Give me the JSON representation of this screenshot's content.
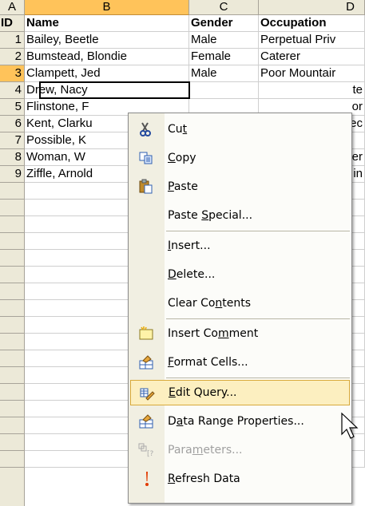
{
  "columns": [
    "A",
    "B",
    "C",
    "D"
  ],
  "header_row": {
    "num": "ID",
    "name": "Name",
    "gender": "Gender",
    "occupation": "Occupation"
  },
  "rows": [
    {
      "num": "1",
      "name": "Bailey, Beetle",
      "gender": "Male",
      "occupation": "Perpetual Priv"
    },
    {
      "num": "2",
      "name": "Bumstead, Blondie",
      "gender": "Female",
      "occupation": "Caterer"
    },
    {
      "num": "3",
      "name": "Clampett, Jed",
      "gender": "Male",
      "occupation": "Poor Mountair"
    },
    {
      "num": "4",
      "name": "Drew, Nacy",
      "gender": "",
      "occupation": "te"
    },
    {
      "num": "5",
      "name": "Flinstone, F",
      "gender": "",
      "occupation": "or"
    },
    {
      "num": "6",
      "name": "Kent, Clarku",
      "gender": "",
      "occupation": "rec"
    },
    {
      "num": "7",
      "name": "Possible, K",
      "gender": "",
      "occupation": ""
    },
    {
      "num": "8",
      "name": "Woman, W",
      "gender": "",
      "occupation": "er"
    },
    {
      "num": "9",
      "name": "Ziffle, Arnold",
      "gender": "",
      "occupation": "in"
    }
  ],
  "context_menu": {
    "items": [
      {
        "pre": "Cu",
        "key": "t",
        "post": "",
        "icon": "cut-icon"
      },
      {
        "pre": "",
        "key": "C",
        "post": "opy",
        "icon": "copy-icon"
      },
      {
        "pre": "",
        "key": "P",
        "post": "aste",
        "icon": "paste-icon"
      },
      {
        "pre": "Paste ",
        "key": "S",
        "post": "pecial...",
        "icon": ""
      },
      {
        "pre": "",
        "key": "I",
        "post": "nsert...",
        "icon": ""
      },
      {
        "pre": "",
        "key": "D",
        "post": "elete...",
        "icon": ""
      },
      {
        "pre": "Clear Co",
        "key": "n",
        "post": "tents",
        "icon": ""
      },
      {
        "pre": "Insert Co",
        "key": "m",
        "post": "ment",
        "icon": "insert-comment-icon"
      },
      {
        "pre": "",
        "key": "F",
        "post": "ormat Cells...",
        "icon": "format-cells-icon"
      },
      {
        "pre": "",
        "key": "E",
        "post": "dit Query...",
        "icon": "edit-query-icon"
      },
      {
        "pre": "D",
        "key": "a",
        "post": "ta Range Properties...",
        "icon": "data-range-properties-icon"
      },
      {
        "pre": "Para",
        "key": "m",
        "post": "eters...",
        "icon": "parameters-icon"
      },
      {
        "pre": "",
        "key": "R",
        "post": "efresh Data",
        "icon": "refresh-data-icon"
      }
    ]
  }
}
